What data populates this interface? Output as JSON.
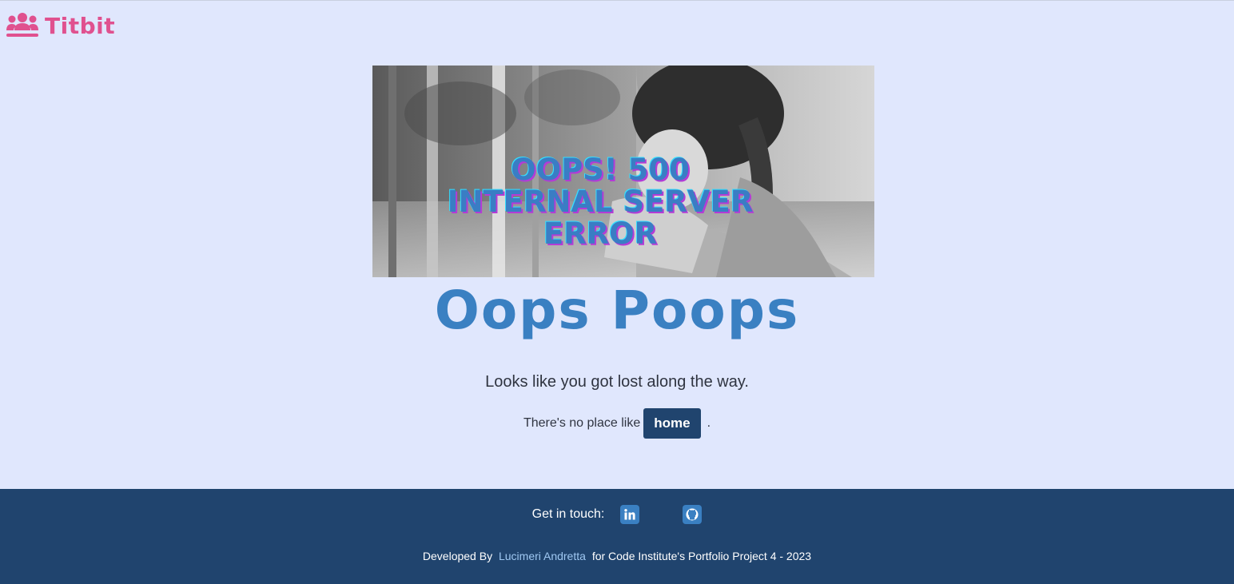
{
  "brand": {
    "name": "Titbit",
    "icon": "users-icon",
    "color": "#e0518f"
  },
  "hero": {
    "image": "crying-girl-photo",
    "overlay_text": "OOPS! 500 INTERNAL SERVER ERROR"
  },
  "main": {
    "headline": "Oops Poops",
    "subline": "Looks like you got lost along the way.",
    "home_prefix": "There's no place like",
    "home_button": "home",
    "home_suffix": "."
  },
  "footer": {
    "contact_label": "Get in touch:",
    "social": [
      {
        "name": "linkedin-icon"
      },
      {
        "name": "github-icon"
      }
    ],
    "credits_prefix": "Developed By",
    "credits_author": "Lucimeri Andretta",
    "credits_suffix": "for Code Institute's Portfolio Project 4 - 2023"
  },
  "colors": {
    "background": "#e0e7fd",
    "footer": "#20446e",
    "accent": "#3a80c2",
    "button": "#20446e"
  }
}
